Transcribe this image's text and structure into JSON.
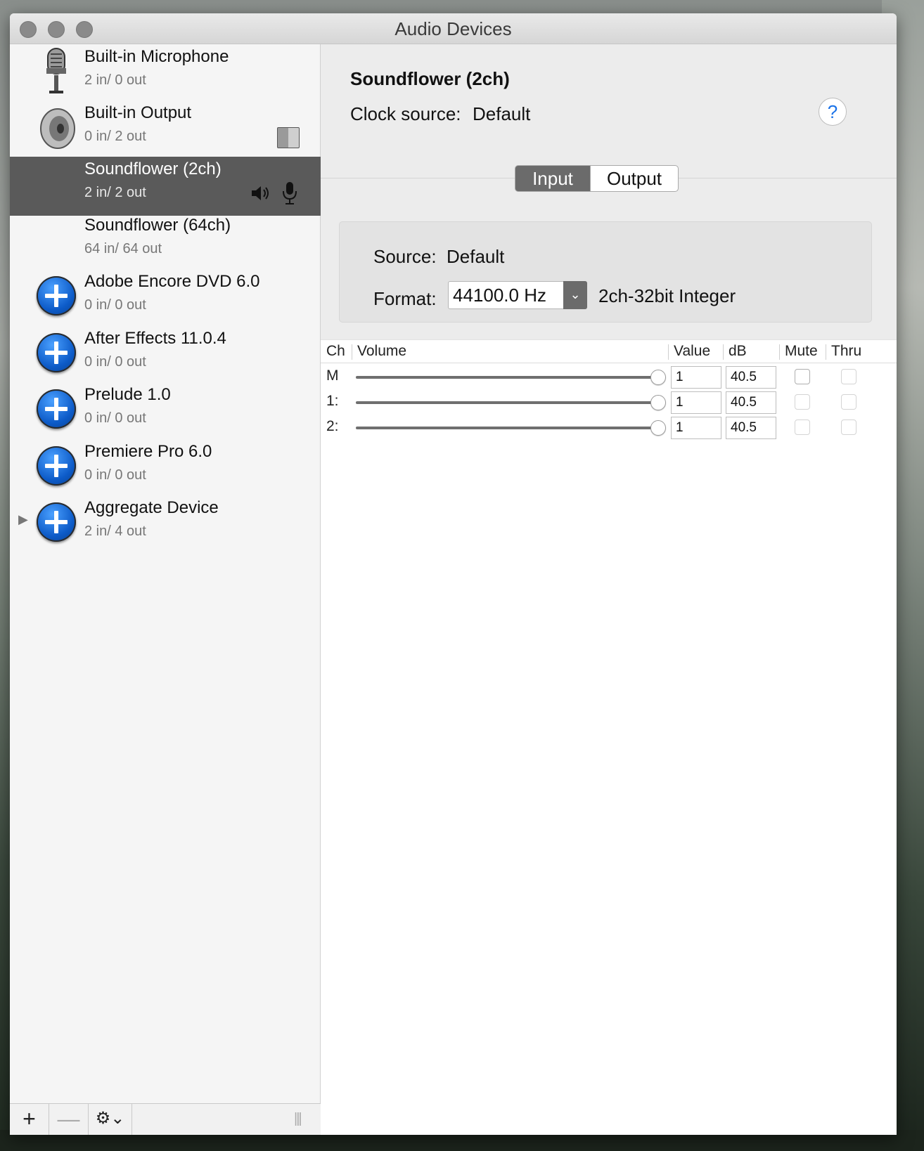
{
  "window": {
    "title": "Audio Devices"
  },
  "devices": [
    {
      "name": "Built-in Microphone",
      "io": "2 in/ 0 out",
      "icon": "microphone-icon"
    },
    {
      "name": "Built-in Output",
      "io": "0 in/ 2 out",
      "icon": "speaker-icon"
    },
    {
      "name": "Soundflower (2ch)",
      "io": "2 in/ 2 out",
      "icon": "none",
      "selected": true
    },
    {
      "name": "Soundflower (64ch)",
      "io": "64 in/ 64 out",
      "icon": "none"
    },
    {
      "name": "Adobe Encore DVD 6.0",
      "io": "0 in/ 0 out",
      "icon": "plus-circle-icon"
    },
    {
      "name": "After Effects 11.0.4",
      "io": "0 in/ 0 out",
      "icon": "plus-circle-icon"
    },
    {
      "name": "Prelude 1.0",
      "io": "0 in/ 0 out",
      "icon": "plus-circle-icon"
    },
    {
      "name": "Premiere Pro 6.0",
      "io": "0 in/ 0 out",
      "icon": "plus-circle-icon"
    },
    {
      "name": "Aggregate Device",
      "io": "2 in/ 4 out",
      "icon": "plus-circle-icon"
    }
  ],
  "sidebar_footer": {
    "add": "+",
    "remove": "—",
    "gear": "⚙⌄",
    "grip": "|||"
  },
  "detail": {
    "device_title": "Soundflower (2ch)",
    "clock_label": "Clock source:",
    "clock_value": "Default",
    "help": "?",
    "tabs": [
      {
        "label": "Input",
        "selected": true
      },
      {
        "label": "Output",
        "selected": false
      }
    ],
    "source_label": "Source:",
    "source_value": "Default",
    "format_label": "Format:",
    "format_value": "44100.0 Hz",
    "format_extra": "2ch-32bit Integer"
  },
  "channels": {
    "headers": {
      "ch": "Ch",
      "volume": "Volume",
      "value": "Value",
      "db": "dB",
      "mute": "Mute",
      "thru": "Thru"
    },
    "rows": [
      {
        "ch": "M",
        "volume": 1.0,
        "value": "1",
        "db": "40.5",
        "mute": false,
        "thru": false
      },
      {
        "ch": "1:",
        "volume": 1.0,
        "value": "1",
        "db": "40.5",
        "mute": false,
        "thru": false
      },
      {
        "ch": "2:",
        "volume": 1.0,
        "value": "1",
        "db": "40.5",
        "mute": false,
        "thru": false
      }
    ]
  },
  "colors": {
    "selection": "#5a5a5a",
    "accent": "#1a72e8",
    "plus_icon": "#0d5bc8"
  }
}
